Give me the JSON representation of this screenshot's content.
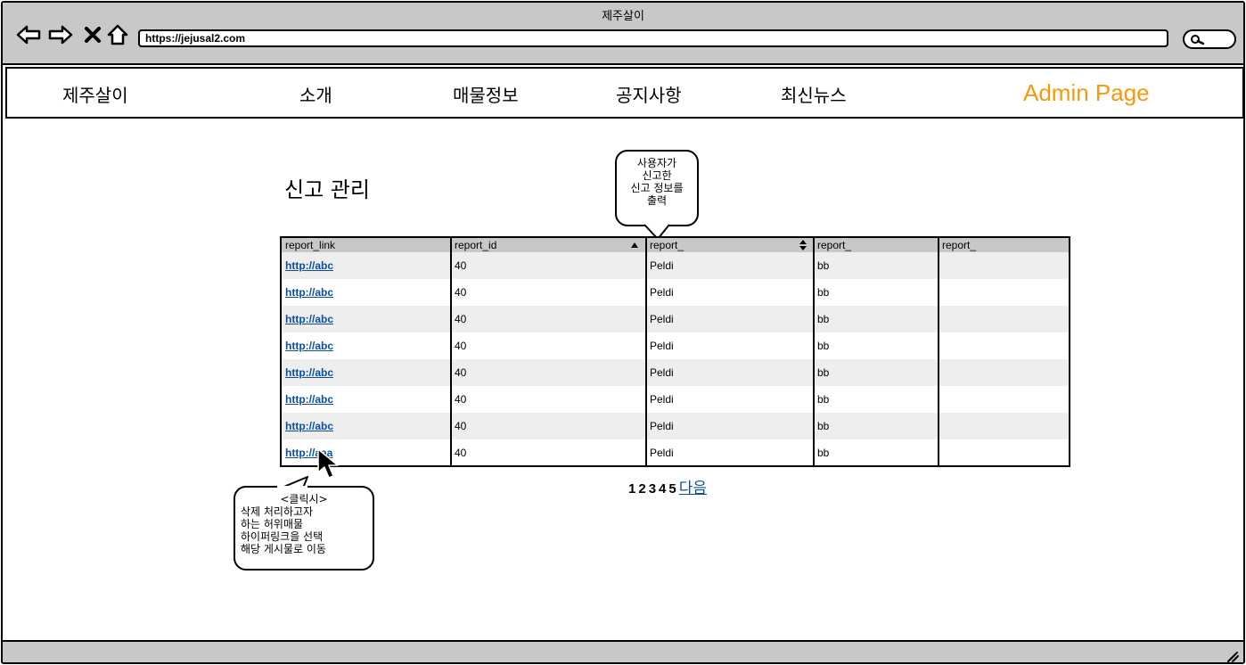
{
  "window": {
    "title": "제주살이"
  },
  "browser": {
    "url": "https://jejusal2.com",
    "icons": [
      "back-arrow-icon",
      "forward-arrow-icon",
      "close-x-icon",
      "home-icon",
      "search-icon"
    ]
  },
  "menu": {
    "brand": "제주살이",
    "items": [
      "소개",
      "매물정보",
      "공지사항",
      "최신뉴스"
    ],
    "admin": "Admin Page",
    "admin_color": "#f59a0c"
  },
  "page": {
    "title": "신고 관리"
  },
  "callout_top": {
    "text": "사용자가\n신고한\n신고 정보를\n출력"
  },
  "callout_bottom": {
    "lines": [
      "<클릭시>",
      "삭제 처리하고자",
      "하는 허위매물",
      "하이퍼링크을 선택",
      "해당 게시물로 이동"
    ]
  },
  "table": {
    "columns": [
      "report_link",
      "report_id",
      "report_",
      "report_",
      "report_"
    ],
    "rows": [
      [
        "http://abc",
        "40",
        "Peldi",
        "bb",
        ""
      ],
      [
        "http://abc",
        "40",
        "Peldi",
        "bb",
        ""
      ],
      [
        "http://abc",
        "40",
        "Peldi",
        "bb",
        ""
      ],
      [
        "http://abc",
        "40",
        "Peldi",
        "bb",
        ""
      ],
      [
        "http://abc",
        "40",
        "Peldi",
        "bb",
        ""
      ],
      [
        "http://abc",
        "40",
        "Peldi",
        "bb",
        ""
      ],
      [
        "http://abc",
        "40",
        "Peldi",
        "bb",
        ""
      ],
      [
        "http://aaa",
        "40",
        "Peldi",
        "bb",
        ""
      ]
    ],
    "link_color": "#0b4f9c",
    "header_color": "#c8c8c8",
    "stripe_color": "#eeeeee"
  },
  "pagination": {
    "pages": [
      "1",
      "2",
      "3",
      "4",
      "5"
    ],
    "next": "다음"
  }
}
